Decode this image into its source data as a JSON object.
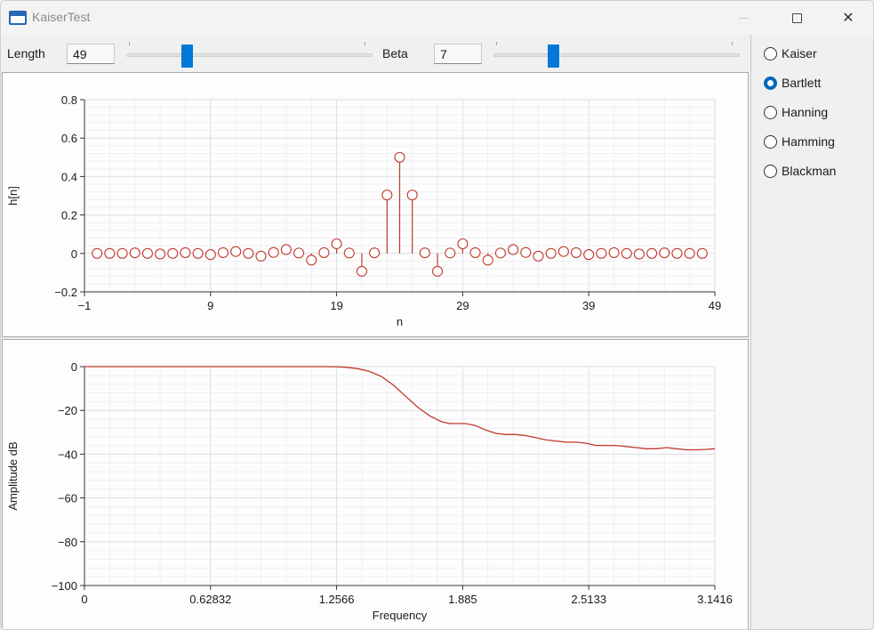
{
  "window": {
    "title": "KaiserTest"
  },
  "controls": {
    "length_label": "Length",
    "length_value": "49",
    "beta_label": "Beta",
    "beta_value": "7"
  },
  "windows": {
    "options": [
      "Kaiser",
      "Bartlett",
      "Hanning",
      "Hamming",
      "Blackman"
    ],
    "selected": "Bartlett"
  },
  "colors": {
    "accent": "#0078d7",
    "series": "#c0392b",
    "grid": "#e6e6ee"
  },
  "chart_data": [
    {
      "type": "stem",
      "xlabel": "n",
      "ylabel": "h[n]",
      "xlim": [
        -1,
        49
      ],
      "ylim": [
        -0.2,
        0.8
      ],
      "xticks": [
        "−1",
        "9",
        "19",
        "29",
        "39",
        "49"
      ],
      "yticks": [
        "−0.2",
        "0",
        "0.2",
        "0.4",
        "0.6",
        "0.8"
      ],
      "x": [
        0,
        1,
        2,
        3,
        4,
        5,
        6,
        7,
        8,
        9,
        10,
        11,
        12,
        13,
        14,
        15,
        16,
        17,
        18,
        19,
        20,
        21,
        22,
        23,
        24,
        25,
        26,
        27,
        28,
        29,
        30,
        31,
        32,
        33,
        34,
        35,
        36,
        37,
        38,
        39,
        40,
        41,
        42,
        43,
        44,
        45,
        46,
        47,
        48
      ],
      "values": [
        0,
        0,
        0,
        0.003,
        0,
        -0.003,
        0,
        0.004,
        0,
        -0.006,
        0.004,
        0.01,
        0,
        -0.014,
        0.005,
        0.02,
        0.002,
        -0.035,
        0.004,
        0.05,
        0.002,
        -0.093,
        0.003,
        0.304,
        0.5,
        0.304,
        0.003,
        -0.093,
        0.002,
        0.05,
        0.004,
        -0.035,
        0.002,
        0.02,
        0.005,
        -0.014,
        0,
        0.01,
        0.004,
        -0.006,
        0,
        0.004,
        0,
        -0.003,
        0,
        0.003,
        0,
        0,
        0
      ]
    },
    {
      "type": "line",
      "xlabel": "Frequency",
      "ylabel": "Amplitude dB",
      "xlim": [
        0,
        3.1416
      ],
      "ylim": [
        -100,
        0
      ],
      "xticks": [
        "0",
        "0.62832",
        "1.2566",
        "1.885",
        "2.5133",
        "3.1416"
      ],
      "yticks": [
        "−100",
        "−80",
        "−60",
        "−40",
        "−20",
        "0"
      ],
      "x": [
        0,
        0.3,
        0.6,
        0.9,
        1.2,
        1.26,
        1.3,
        1.36,
        1.42,
        1.48,
        1.54,
        1.6,
        1.66,
        1.72,
        1.78,
        1.82,
        1.86,
        1.9,
        1.95,
        2.0,
        2.05,
        2.1,
        2.15,
        2.2,
        2.25,
        2.3,
        2.35,
        2.4,
        2.45,
        2.5,
        2.55,
        2.6,
        2.65,
        2.7,
        2.75,
        2.8,
        2.85,
        2.9,
        2.95,
        3.0,
        3.05,
        3.1,
        3.1416
      ],
      "values": [
        0,
        0,
        0,
        0,
        0,
        -0.1,
        -0.3,
        -0.9,
        -2.2,
        -4.5,
        -8.5,
        -13.5,
        -18.5,
        -22.5,
        -25.2,
        -26,
        -26,
        -26,
        -27,
        -29,
        -30.5,
        -31,
        -31,
        -31.5,
        -32.5,
        -33.5,
        -34,
        -34.5,
        -34.5,
        -35,
        -36,
        -36,
        -36,
        -36.5,
        -37,
        -37.5,
        -37.5,
        -37,
        -37.5,
        -38,
        -38,
        -37.8,
        -37.5
      ]
    }
  ]
}
